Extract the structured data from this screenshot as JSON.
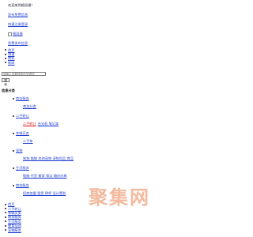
{
  "top": {
    "welcome": "欢迎来到格局通！",
    "post_link": "发布免费信息",
    "quick_login": "快速注册登录"
  },
  "logo": {
    "alt": "格局通",
    "slogan": "免费发布信息"
  },
  "nav": [
    {
      "label": "首页"
    },
    {
      "label": "频道"
    },
    {
      "label": "商机"
    },
    {
      "label": "新闻"
    }
  ],
  "search": {
    "placeholder": "请输入你要搜索的关键词",
    "button": "搜 索"
  },
  "categories_title": "信息分类",
  "categories": [
    {
      "name": "商务服务",
      "links": [
        "商务分类"
      ]
    },
    {
      "name": "二手转让",
      "links": [
        "二手转让",
        "台式机 笔记本"
      ]
    },
    {
      "name": "车辆买卖",
      "links": [
        "二手车"
      ]
    },
    {
      "name": "宠物",
      "links": [
        "狗狗 猫猫 其他宠物 宠物用品 食品"
      ]
    },
    {
      "name": "生活服务",
      "links": [
        "鞋服 代宣 搬家 保洁 婚庆庆典"
      ]
    },
    {
      "name": "商务服务",
      "links": [
        "招商加盟 租赁 律师 设计策划"
      ]
    }
  ],
  "footer_links": [
    {
      "label": "首页"
    },
    {
      "label": "二手转让"
    },
    {
      "label": "车辆买卖"
    },
    {
      "label": "商务服务"
    },
    {
      "label": "生活服务"
    },
    {
      "label": "教育培训"
    },
    {
      "label": "宠物服务"
    }
  ],
  "watermark": "聚集网"
}
